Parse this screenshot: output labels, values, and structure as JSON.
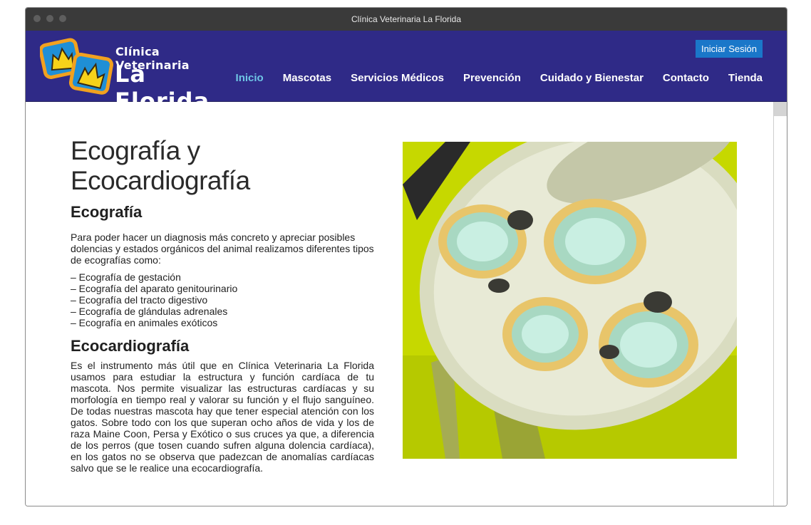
{
  "window": {
    "title": "Clínica Veterinaria La Florida"
  },
  "header": {
    "logo_line1": "Clínica Veterinaria",
    "logo_line2": "La Florida",
    "login_label": "Iniciar Sesión",
    "menu": [
      {
        "label": "Inicio",
        "active": true
      },
      {
        "label": "Mascotas"
      },
      {
        "label": "Servicios Médicos"
      },
      {
        "label": "Prevención"
      },
      {
        "label": "Cuidado y Bienestar"
      },
      {
        "label": "Contacto"
      },
      {
        "label": "Tienda"
      }
    ]
  },
  "main": {
    "page_title": "Ecografía y Ecocardiografía",
    "section1": {
      "heading": "Ecografía",
      "intro": "Para poder hacer un diagnosis más concreto y apreciar posibles dolencias y estados orgánicos del animal realizamos diferentes tipos de ecografías como:",
      "items": [
        "– Ecografía de gestación",
        "– Ecografía del aparato genitourinario",
        "– Ecografía del tracto digestivo",
        "– Ecografía de glándulas adrenales",
        "– Ecografía en animales exóticos"
      ]
    },
    "section2": {
      "heading": "Ecocardiografía",
      "body": "Es el instrumento más útil que en Clínica Veterinaria La Florida usamos para estudiar la estructura y función cardíaca de tu mascota. Nos permite visualizar las estructuras cardíacas y su morfología en tiempo real y valorar su función y el flujo sanguíneo. De todas nuestras mascota hay que tener especial atención con los gatos. Sobre todo con los que superan ocho años de vida y los de raza Maine Coon, Persa y Exótico o sus cruces ya que, a diferencia de los perros (que tosen cuando sufren alguna dolencia cardíaca), en los gatos no se observa que padezcan de anomalías cardíacas salvo que se le realice una ecocardiografía."
    }
  },
  "colors": {
    "navbar": "#2f2a87",
    "active_menu": "#6fc6e6",
    "login_button": "#1a77c9",
    "photo_bg": "#c9db00"
  }
}
